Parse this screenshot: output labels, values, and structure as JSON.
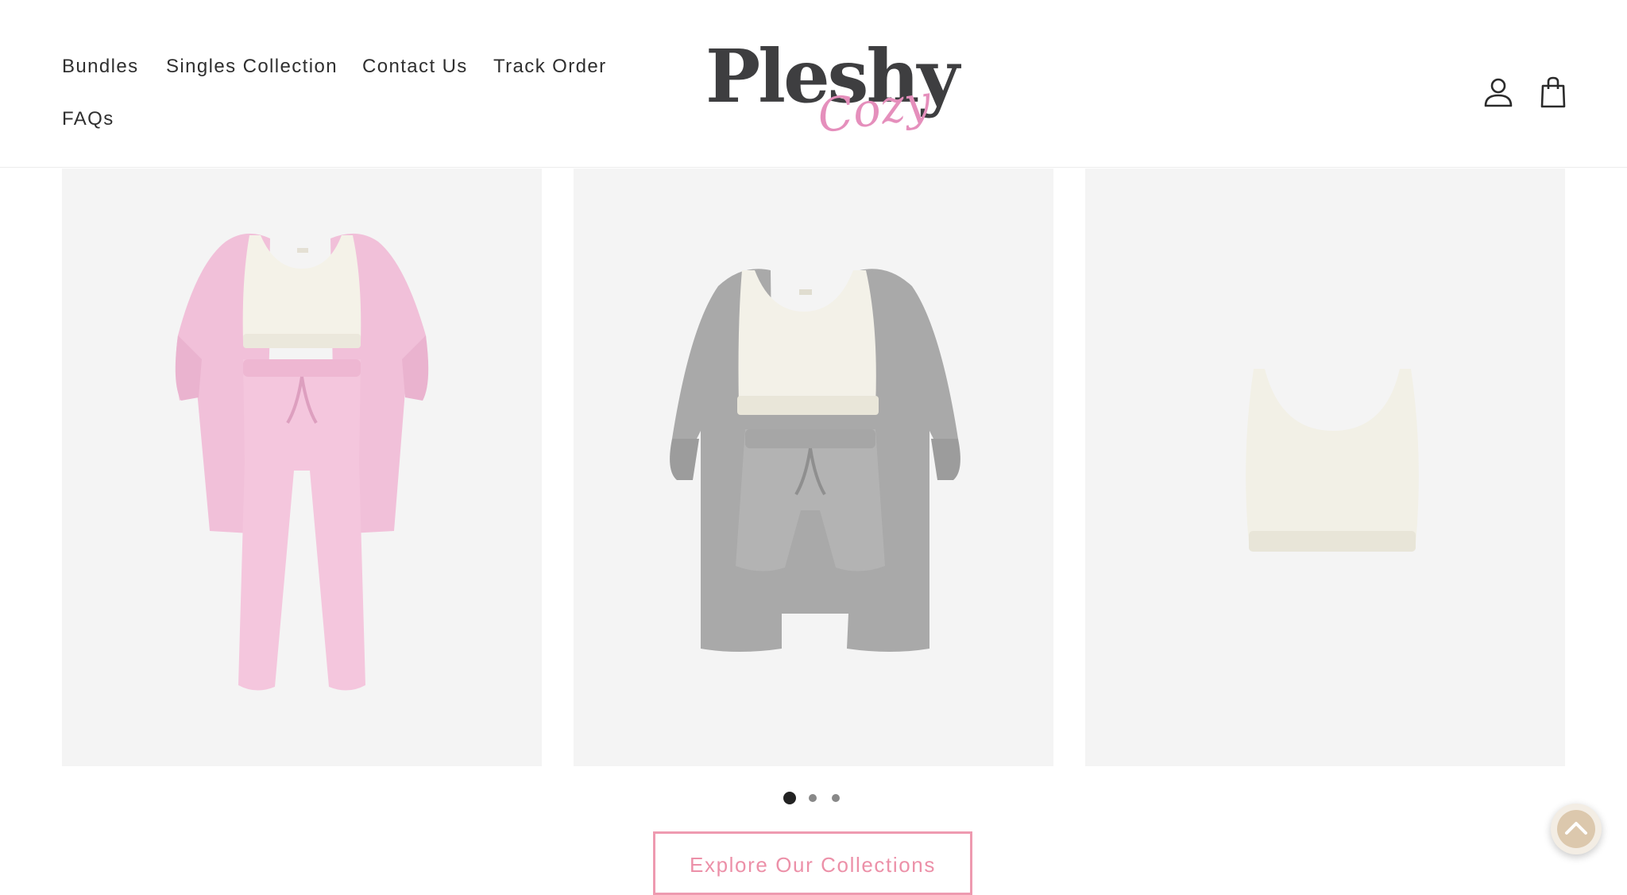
{
  "header": {
    "nav": [
      {
        "label": "Bundles"
      },
      {
        "label": "Singles Collection"
      },
      {
        "label": "Contact Us"
      },
      {
        "label": "Track Order"
      },
      {
        "label": "FAQs"
      }
    ],
    "logo": {
      "brand": "Pleshy",
      "sub": "Cozy"
    },
    "icons": {
      "account": "account-icon",
      "cart": "shopping-bag-icon"
    }
  },
  "carousel": {
    "products": [
      {
        "name": "pink cardigan, crop top and jogger set",
        "color": "#f4c6dd"
      },
      {
        "name": "grey cardigan, crop top and shorts set",
        "color": "#b5b5b5"
      },
      {
        "name": "cream crop top",
        "color": "#f3f1e8"
      }
    ],
    "pagination": {
      "current": 1,
      "total": 3
    },
    "cta_label": "Explore Our Collections"
  },
  "scroll_top": {
    "icon": "chevron-up-icon"
  },
  "colors": {
    "accent": "#ee9ab0",
    "text": "#2f2f2f",
    "card_bg": "#f4f4f4"
  }
}
